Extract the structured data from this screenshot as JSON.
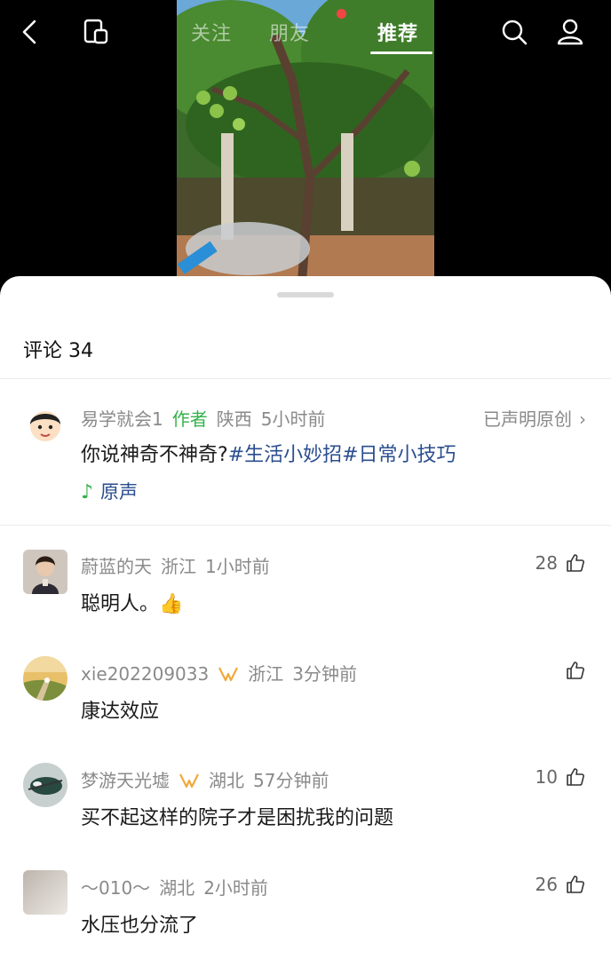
{
  "nav": {
    "tabs": [
      {
        "label": "关注"
      },
      {
        "label": "朋友"
      },
      {
        "label": "推荐"
      }
    ]
  },
  "sheet": {
    "title": "评论 34"
  },
  "post": {
    "author": "易学就会1",
    "author_tag": "作者",
    "location": "陕西",
    "time": "5小时前",
    "original_claim": "已声明原创",
    "text_prefix": "你说神奇不神奇?",
    "hashtags": [
      "#生活小妙招",
      "#日常小技巧"
    ],
    "music_label": "原声"
  },
  "comments": [
    {
      "name": "蔚蓝的天",
      "location": "浙江",
      "time": "1小时前",
      "text": "聪明人。👍",
      "likes": "28"
    },
    {
      "name": "xie202209033",
      "location": "浙江",
      "time": "3分钟前",
      "text": "康达效应",
      "likes": ""
    },
    {
      "name": "梦游天光墟",
      "location": "湖北",
      "time": "57分钟前",
      "text": "买不起这样的院子才是困扰我的问题",
      "likes": "10"
    },
    {
      "name": "～010～",
      "location": "湖北",
      "time": "2小时前",
      "text": "水压也分流了",
      "likes": "26"
    }
  ],
  "colors": {
    "author_tag": "#35b24a",
    "hashtag": "#2a4d8f",
    "meta_gray": "#8a8a8a",
    "badge_orange": "#f0a93a"
  }
}
